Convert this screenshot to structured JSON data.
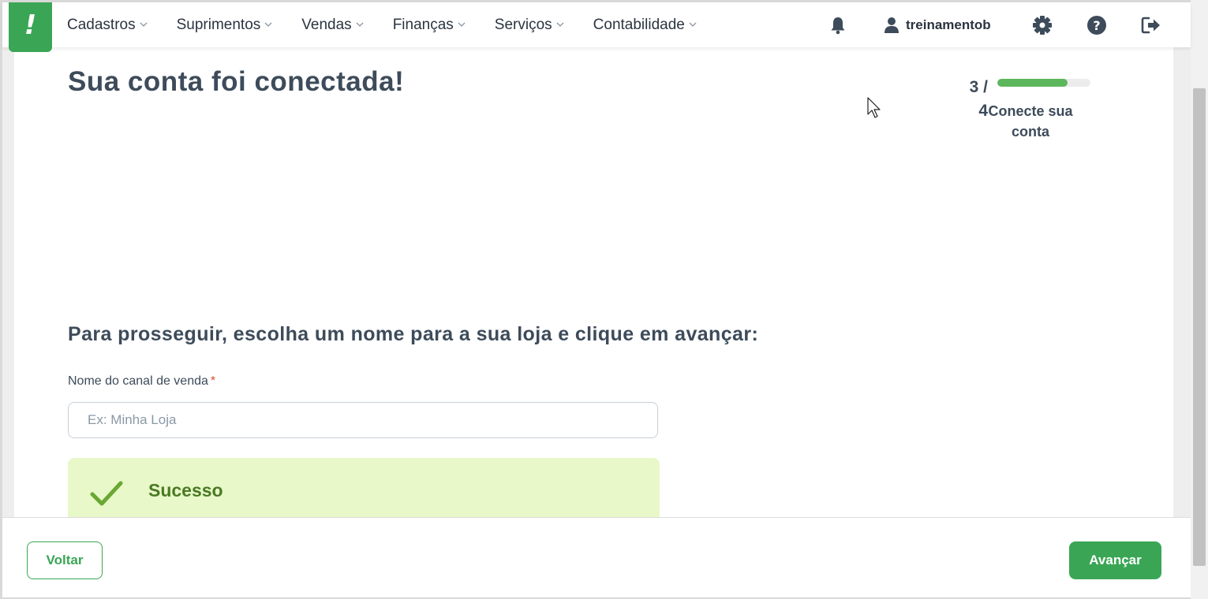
{
  "brand": {
    "logo_text": "!",
    "accent": "#3aa655"
  },
  "nav": {
    "items": [
      {
        "label": "Cadastros"
      },
      {
        "label": "Suprimentos"
      },
      {
        "label": "Vendas"
      },
      {
        "label": "Finanças"
      },
      {
        "label": "Serviços"
      },
      {
        "label": "Contabilidade"
      }
    ]
  },
  "header": {
    "icons": [
      "bell-icon",
      "user-icon",
      "gear-icon",
      "help-icon",
      "logout-icon"
    ],
    "username": "treinamentob"
  },
  "main": {
    "title": "Sua conta foi conectada!",
    "progress": {
      "step": "3 / 4",
      "fraction": 0.75,
      "label": "Conecte sua conta"
    },
    "instruction": "Para prosseguir, escolha um nome para a sua loja e clique em avançar:",
    "field": {
      "label": "Nome do canal de venda",
      "required_mark": "*",
      "placeholder": "Ex: Minha Loja",
      "value": ""
    },
    "alert": {
      "title": "Sucesso",
      "color": "#e8f8c8"
    }
  },
  "footer": {
    "back_label": "Voltar",
    "next_label": "Avançar"
  }
}
